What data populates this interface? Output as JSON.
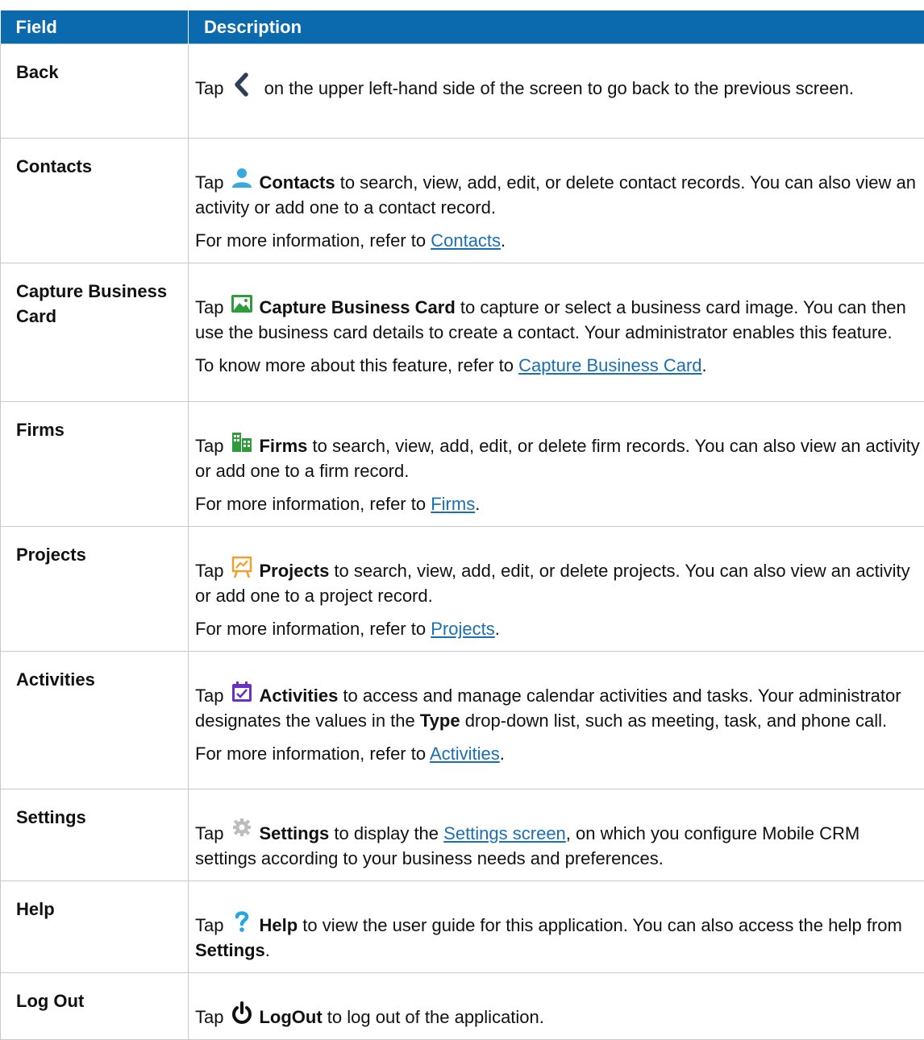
{
  "header": {
    "field": "Field",
    "description": "Description"
  },
  "rows": [
    {
      "field": "Back",
      "icon": "chevron-left-icon",
      "p1": {
        "pre": "Tap",
        "post": " on the upper left-hand side of the screen to go back to the previous screen."
      }
    },
    {
      "field": "Contacts",
      "icon": "contact-person-icon",
      "p1": {
        "pre": "Tap",
        "bold": "Contacts",
        "post": " to search, view, add, edit, or delete contact records. You can also view an activity or add one to a contact record."
      },
      "p2": {
        "pre": "For more information, refer to ",
        "link": "Contacts",
        "post": "."
      }
    },
    {
      "field": "Capture Business Card",
      "icon": "image-picture-icon",
      "p1": {
        "pre": "Tap",
        "bold": "Capture Business Card",
        "post": " to capture or select a business card image. You can then use the business card details to create a contact. Your administrator enables this feature."
      },
      "p2": {
        "pre": "To know more about this feature, refer to ",
        "link": "Capture Business Card",
        "post": "."
      }
    },
    {
      "field": "Firms",
      "icon": "buildings-icon",
      "p1": {
        "pre": "Tap",
        "bold": "Firms",
        "post": " to search, view, add, edit, or delete firm records. You can also view an activity or add one to a firm record."
      },
      "p2": {
        "pre": "For more information, refer to ",
        "link": "Firms",
        "post": "."
      }
    },
    {
      "field": "Projects",
      "icon": "presentation-board-icon",
      "p1": {
        "pre": "Tap",
        "bold": "Projects",
        "post": " to search, view, add, edit, or delete projects. You can also view an activity or add one to a project record."
      },
      "p2": {
        "pre": "For more information, refer to ",
        "link": "Projects",
        "post": "."
      }
    },
    {
      "field": "Activities",
      "icon": "calendar-check-icon",
      "p1": {
        "pre": "Tap",
        "bold": "Activities",
        "post": " to access and manage calendar activities and tasks. Your administrator designates the values in the ",
        "bold2": "Type",
        "post2": " drop-down list, such as meeting, task, and phone call."
      },
      "p2": {
        "pre": "For more information, refer to ",
        "link": "Activities",
        "post": "."
      }
    },
    {
      "field": "Settings",
      "icon": "gear-icon",
      "p1": {
        "pre": "Tap",
        "bold": "Settings",
        "post": " to display the ",
        "link": "Settings screen",
        "post2": ", on which you configure Mobile CRM settings according to your business needs and preferences."
      }
    },
    {
      "field": "Help",
      "icon": "question-mark-icon",
      "p1": {
        "pre": "Tap",
        "bold": "Help",
        "post": " to view the user guide for this application. You can also access the help from ",
        "bold2": "Settings",
        "post2": "."
      }
    },
    {
      "field": "Log Out",
      "icon": "power-icon",
      "p1": {
        "pre": "Tap",
        "bold": "LogOut",
        "post": " to log out of the application."
      }
    }
  ],
  "colors": {
    "header_bg": "#0a6aad",
    "link": "#1a6fb3",
    "contacts_icon": "#3aa9e0",
    "capture_icon": "#2e9c3a",
    "firms_icon": "#2e9c3a",
    "projects_icon": "#f0a030",
    "activities_icon": "#6a2fc4",
    "settings_icon": "#bdbdbd",
    "help_icon": "#22a7e0"
  }
}
